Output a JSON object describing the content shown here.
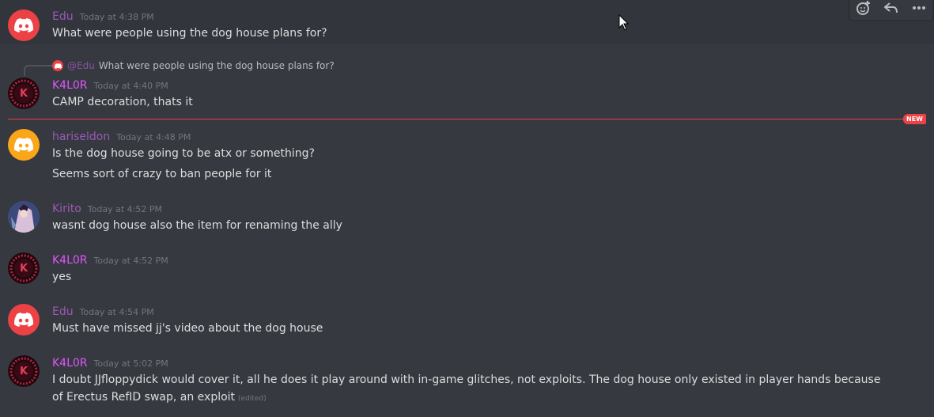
{
  "colors": {
    "background": "#36393f",
    "username_purple": "#9b59b6",
    "username_pink": "#e255ff",
    "new_red": "#ed4245",
    "edu_avatar": "#ed4245",
    "hariseldon_avatar": "#faa61a"
  },
  "toolbar": {
    "icons": [
      "add-reaction-icon",
      "reply-icon",
      "more-icon"
    ]
  },
  "messages": [
    {
      "user": "Edu",
      "time": "Today at 4:38 PM",
      "lines": [
        "What were people using the dog house plans for?"
      ]
    },
    {
      "user": "K4L0R",
      "time": "Today at 4:40 PM",
      "lines": [
        "CAMP decoration, thats it"
      ],
      "reply": {
        "user": "@Edu",
        "text": "What were people using the dog house plans for?"
      }
    },
    {
      "user": "hariseldon",
      "time": "Today at 4:48 PM",
      "lines": [
        "Is the dog house going to be atx or something?",
        "Seems sort of crazy to ban people for it"
      ]
    },
    {
      "user": "Kirito",
      "time": "Today at 4:52 PM",
      "lines": [
        "wasnt dog house also the item for renaming the ally"
      ]
    },
    {
      "user": "K4L0R",
      "time": "Today at 4:52 PM",
      "lines": [
        "yes"
      ]
    },
    {
      "user": "Edu",
      "time": "Today at 4:54 PM",
      "lines": [
        "Must have missed jj's video about the dog house"
      ]
    },
    {
      "user": "K4L0R",
      "time": "Today at 5:02 PM",
      "lines": [
        "I doubt JJfloppydick would cover it, all he does it play around with in-game glitches, not exploits. The dog house only existed in player hands because of Erectus RefID swap, an exploit"
      ],
      "edited": "(edited)"
    }
  ],
  "divider": {
    "badge": "NEW"
  },
  "avatar_letter": "K"
}
